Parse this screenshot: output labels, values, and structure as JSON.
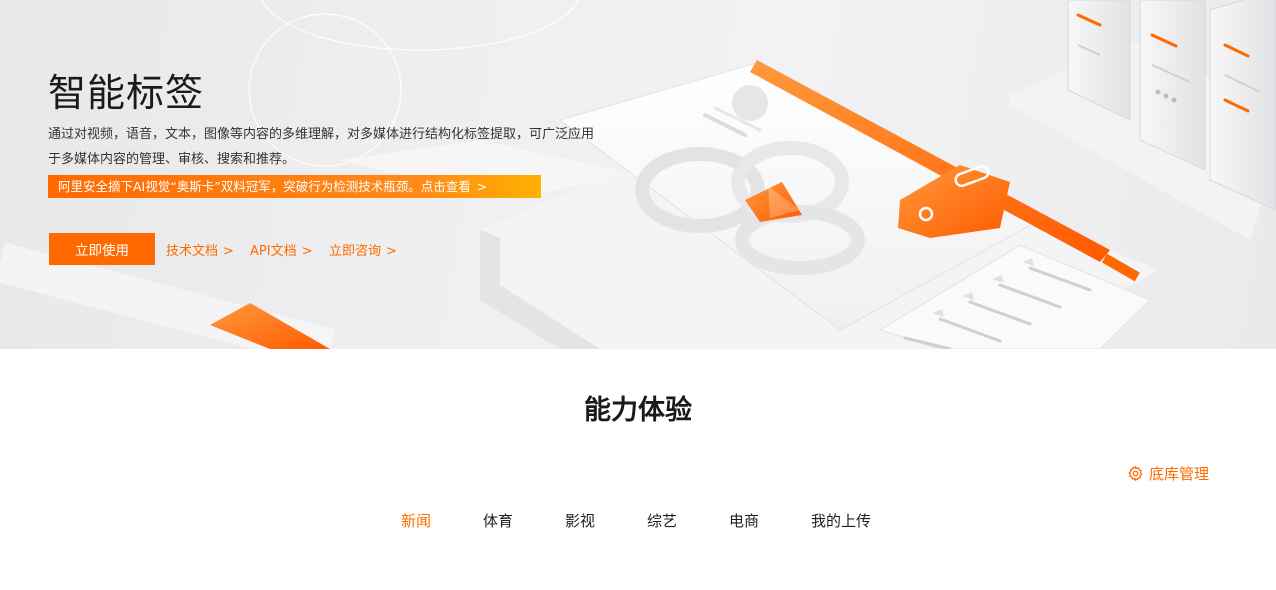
{
  "hero": {
    "title": "智能标签",
    "description_line1": "通过对视频，语音，文本，图像等内容的多维理解，对多媒体进行结构化标签提取，可广泛应用",
    "description_line2": "于多媒体内容的管理、审核、搜索和推荐。",
    "promo_text": "阿里安全摘下AI视觉“奥斯卡”双料冠军，突破行为检测技术瓶颈。点击查看",
    "primary_button": "立即使用",
    "links": [
      "技术文档",
      "API文档",
      "立即咨询"
    ],
    "link_chevron": "〉"
  },
  "section": {
    "title": "能力体验",
    "library_manage_label": "底库管理"
  },
  "tabs": [
    {
      "label": "新闻",
      "active": true
    },
    {
      "label": "体育",
      "active": false
    },
    {
      "label": "影视",
      "active": false
    },
    {
      "label": "综艺",
      "active": false
    },
    {
      "label": "电商",
      "active": false
    },
    {
      "label": "我的上传",
      "active": false
    }
  ],
  "icons": {
    "library_manage": "gear-icon",
    "play": "play-icon",
    "tag": "tag-icon"
  },
  "colors": {
    "accent": "#ff6a00",
    "accent_gradient_end": "#ffb000",
    "hero_bg": "#efeff1",
    "text": "#1f1f1f"
  }
}
